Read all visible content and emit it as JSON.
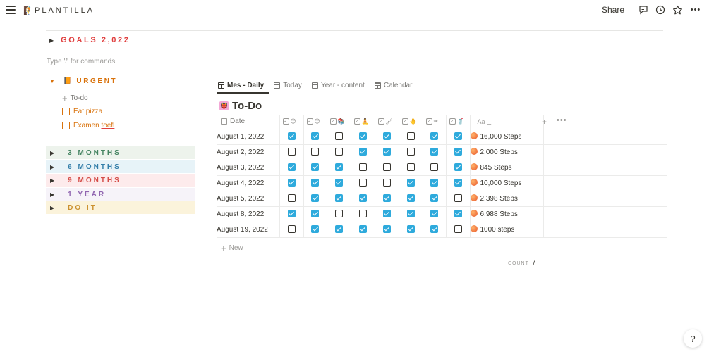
{
  "topbar": {
    "page_emoji": "🧗",
    "title": "PLANTILLA",
    "share_label": "Share",
    "more_label": "•••"
  },
  "goals": {
    "label": "GOALS 2,022"
  },
  "placeholder": "Type '/' for commands",
  "urgent": {
    "icon": "📙",
    "label": "URGENT",
    "add_label": "To-do",
    "items": [
      {
        "text": "Eat pizza"
      },
      {
        "text_a": "Examen ",
        "text_b": "toefl"
      }
    ]
  },
  "toggles": [
    {
      "label": "3 MONTHS",
      "color": "#448361",
      "bg": "#edf3ec"
    },
    {
      "label": "6 MONTHS",
      "color": "#337ea9",
      "bg": "#e7f3f8"
    },
    {
      "label": "9 MONTHS",
      "color": "#d44c47",
      "bg": "#fdebec"
    },
    {
      "label": "1 YEAR",
      "color": "#9065b0",
      "bg": "#f6f3f9"
    },
    {
      "label": "DO IT",
      "color": "#cb912f",
      "bg": "#fbf3db"
    }
  ],
  "database": {
    "views": [
      {
        "label": "Mes - Daily"
      },
      {
        "label": "Today"
      },
      {
        "label": "Year - content"
      },
      {
        "label": "Calendar"
      }
    ],
    "title_emoji": "👹",
    "title": "To-Do",
    "columns": {
      "date": "Date",
      "checks": [
        "😊",
        "😊",
        "📚",
        "🧘",
        "🖌",
        "🤚",
        "✂",
        "🥤"
      ],
      "name_icon": "Aa",
      "name": "_"
    },
    "rows": [
      {
        "date": "August 1, 2022",
        "checks": [
          true,
          true,
          false,
          true,
          true,
          false,
          true,
          true
        ],
        "steps": "16,000 Steps"
      },
      {
        "date": "August 2, 2022",
        "checks": [
          false,
          false,
          false,
          true,
          true,
          false,
          true,
          true
        ],
        "steps": "2,000 Steps"
      },
      {
        "date": "August 3, 2022",
        "checks": [
          true,
          true,
          true,
          false,
          false,
          false,
          false,
          true
        ],
        "steps": "845 Steps"
      },
      {
        "date": "August 4, 2022",
        "checks": [
          true,
          true,
          true,
          false,
          false,
          true,
          true,
          true
        ],
        "steps": "10,000 Steps"
      },
      {
        "date": "August 5, 2022",
        "checks": [
          false,
          true,
          true,
          true,
          true,
          true,
          true,
          false
        ],
        "steps": "2,398 Steps"
      },
      {
        "date": "August 8, 2022",
        "checks": [
          true,
          true,
          false,
          false,
          true,
          true,
          true,
          true
        ],
        "steps": "6,988 Steps"
      },
      {
        "date": "August 19, 2022",
        "checks": [
          false,
          true,
          true,
          true,
          true,
          true,
          true,
          false
        ],
        "steps": "1000 steps"
      }
    ],
    "new_label": "New",
    "count_label": "COUNT",
    "count_value": "7"
  },
  "help_label": "?"
}
